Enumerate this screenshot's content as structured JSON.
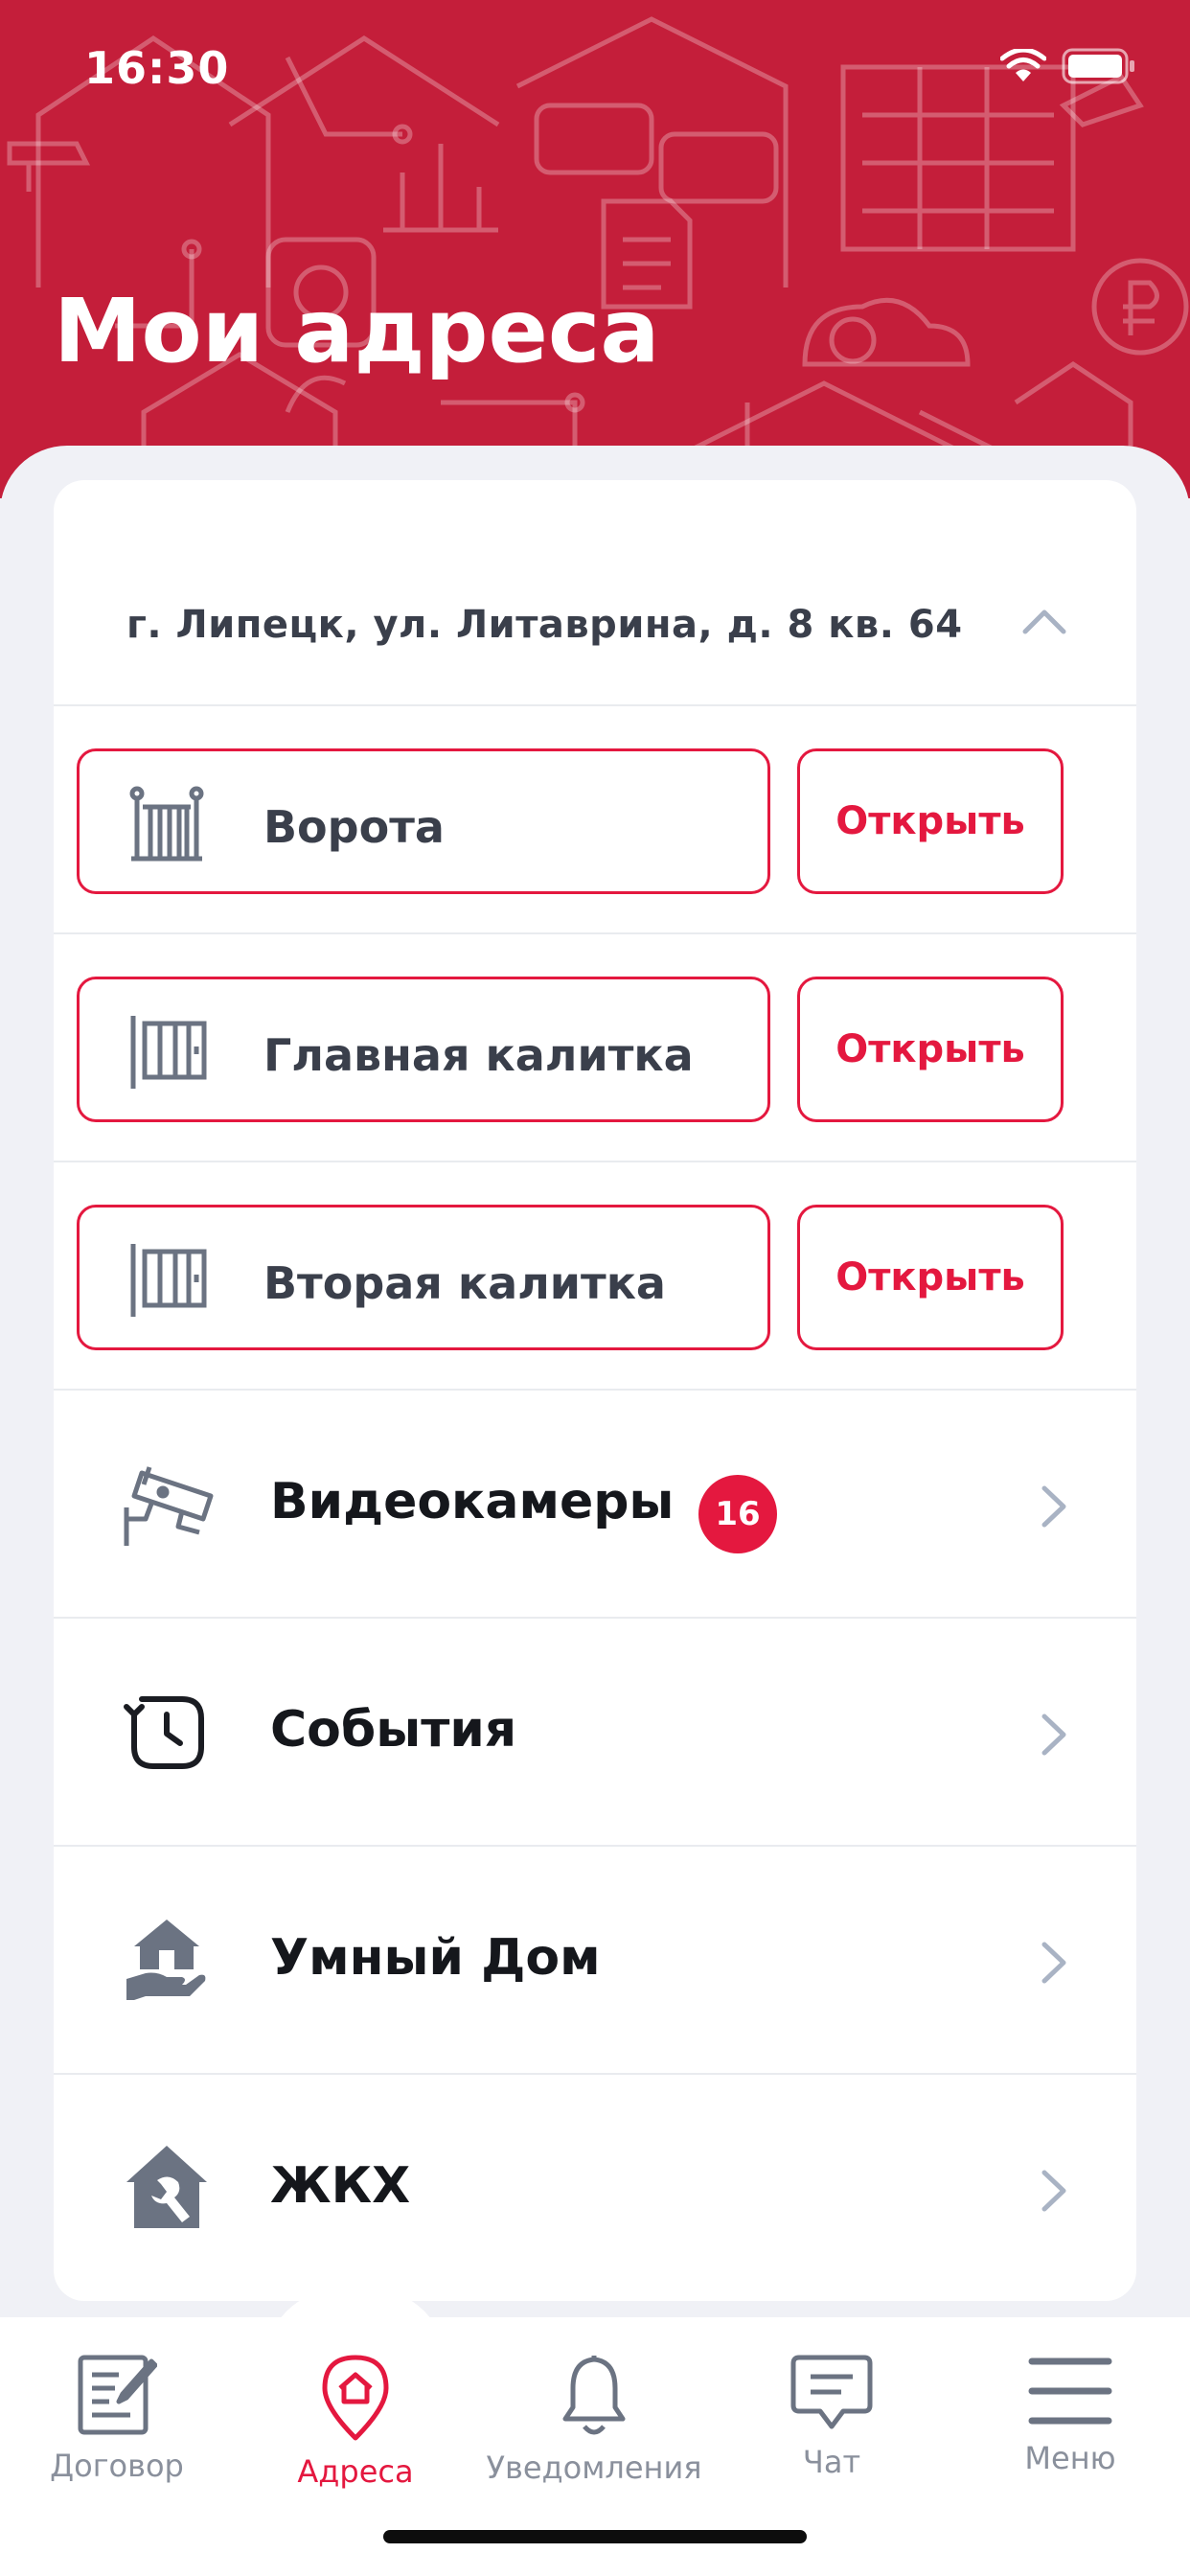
{
  "status_bar": {
    "time": "16:30"
  },
  "header": {
    "title": "Мои адреса"
  },
  "address": {
    "text": "г. Липецк, ул. Литаврина, д. 8 кв. 64"
  },
  "doors": [
    {
      "label": "Ворота",
      "action": "Открыть",
      "icon": "gate-icon"
    },
    {
      "label": "Главная калитка",
      "action": "Открыть",
      "icon": "wicket-icon"
    },
    {
      "label": "Вторая калитка",
      "action": "Открыть",
      "icon": "wicket-icon"
    }
  ],
  "menu": [
    {
      "label": "Видеокамеры",
      "badge": "16",
      "icon": "camera-icon"
    },
    {
      "label": "События",
      "icon": "history-icon"
    },
    {
      "label": "Умный Дом",
      "icon": "smart-home-icon"
    },
    {
      "label": "ЖКХ",
      "icon": "utilities-icon"
    }
  ],
  "tabbar": {
    "tabs": [
      {
        "label": "Договор",
        "icon": "contract-icon",
        "active": false
      },
      {
        "label": "Адреса",
        "icon": "address-pin-icon",
        "active": true
      },
      {
        "label": "Уведомления",
        "icon": "bell-icon",
        "active": false
      },
      {
        "label": "Чат",
        "icon": "chat-icon",
        "active": false
      },
      {
        "label": "Меню",
        "icon": "hamburger-icon",
        "active": false
      }
    ]
  },
  "colors": {
    "header": "#c41e3a",
    "accent": "#e4183f",
    "icon_gray": "#6b7382",
    "chevron": "#a9b3c4"
  }
}
